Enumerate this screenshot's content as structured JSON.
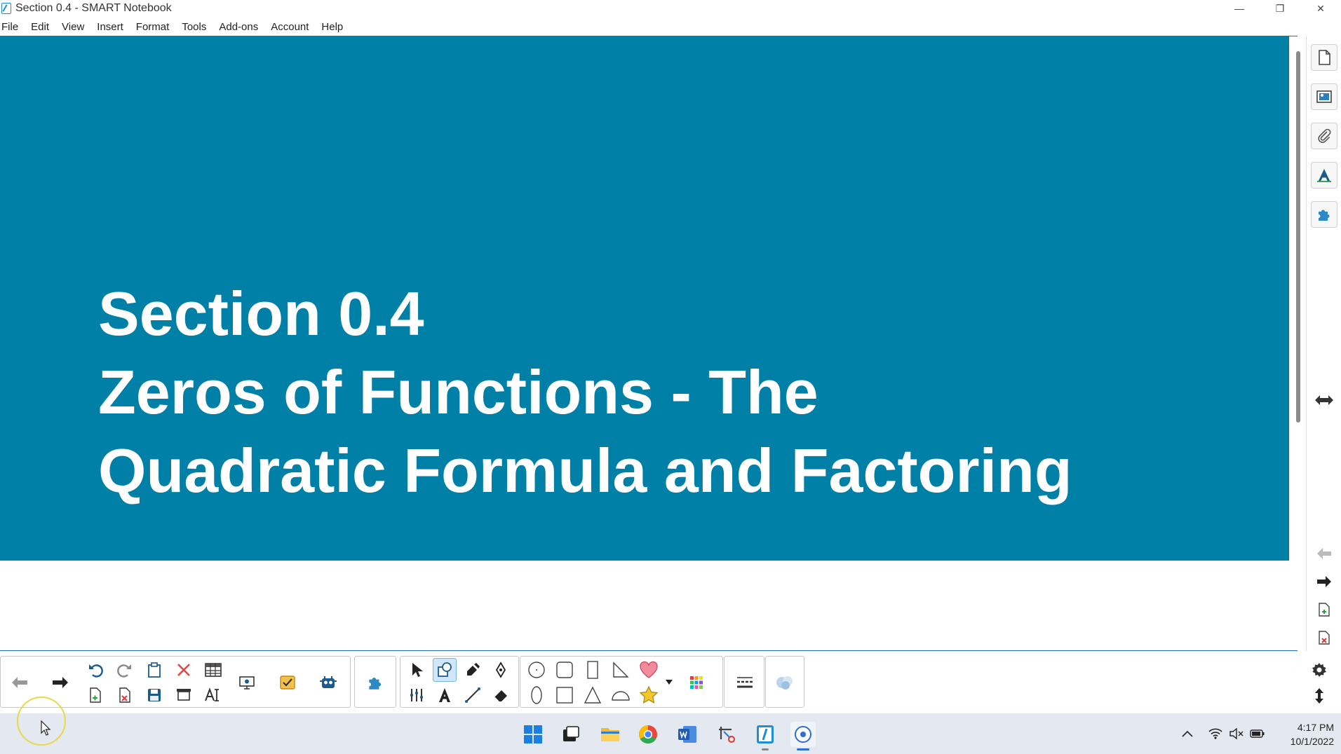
{
  "window": {
    "title": "Section 0.4 - SMART Notebook",
    "minimize": "—",
    "restore": "❐",
    "close": "✕"
  },
  "menu": {
    "items": [
      "File",
      "Edit",
      "View",
      "Insert",
      "Format",
      "Tools",
      "Add-ons",
      "Account",
      "Help"
    ]
  },
  "slide": {
    "lines": [
      "Section 0.4",
      "Zeros of Functions - The",
      "Quadratic Formula and Factoring"
    ],
    "background": "#0080a6"
  },
  "taskbar": {
    "time": "4:17 PM",
    "date": "10/1/2022"
  },
  "colors": {
    "accent": "#1f6cc1",
    "slide_bg": "#0080a6",
    "active_tool": "#cfe6fb"
  }
}
